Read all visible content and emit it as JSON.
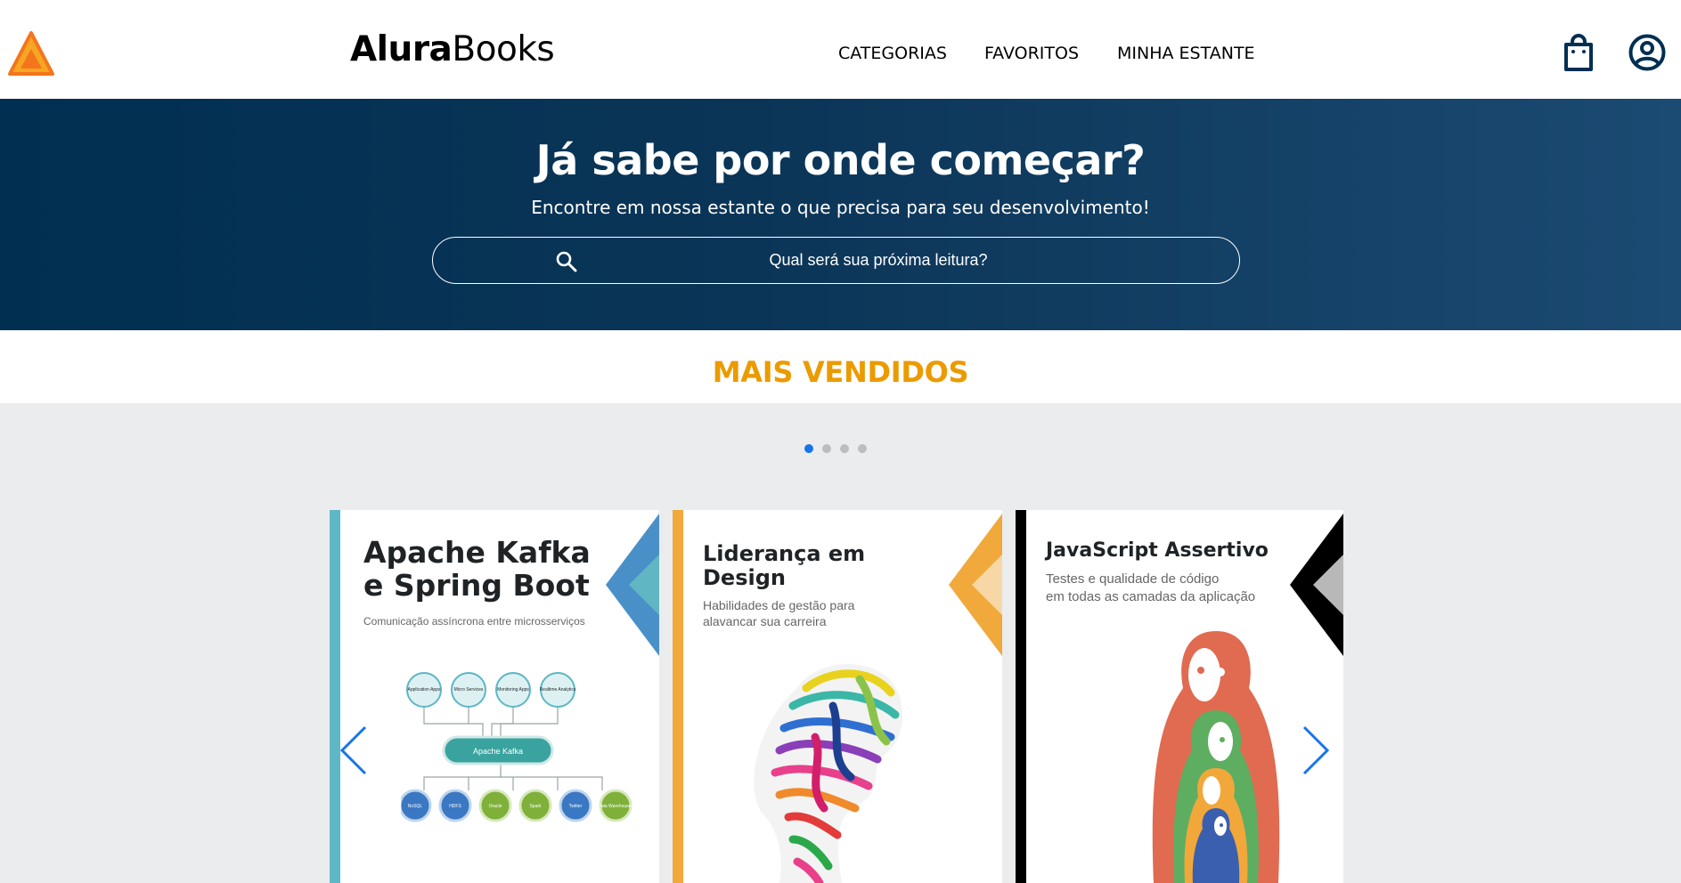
{
  "header": {
    "brand_bold": "Alura",
    "brand_light": "Books",
    "nav": [
      "CATEGORIAS",
      "FAVORITOS",
      "MINHA ESTANTE"
    ],
    "icons": [
      "logo-triangle-icon",
      "shopping-bag-icon",
      "user-account-icon"
    ]
  },
  "hero": {
    "title": "Já sabe por onde começar?",
    "subtitle": "Encontre em nossa estante o que precisa para seu desenvolvimento!",
    "search_placeholder": "Qual será sua próxima leitura?"
  },
  "section": {
    "title": "MAIS VENDIDOS",
    "carousel_pages": 4,
    "active_page": 1
  },
  "books": [
    {
      "title": "Apache Kafka\ne Spring Boot",
      "subtitle": "Comunicação assíncrona entre microsserviços",
      "accent": "#4A90C8",
      "spine": "#5DB7C4",
      "diagram": {
        "top": [
          "Application Apps",
          "Micro Services",
          "Monitoring Apps",
          "Realtime Analytics"
        ],
        "center": "Apache Kafka",
        "bottom": [
          "NoSQL",
          "HDFS",
          "Oracle",
          "Spark",
          "Twitter",
          "Data Warehouses"
        ]
      }
    },
    {
      "title": "Liderança em\nDesign",
      "subtitle": "Habilidades de gestão para\nalavancar sua carreira",
      "accent": "#F0A93A",
      "spine": "#F0A93A"
    },
    {
      "title": "JavaScript Assertivo",
      "subtitle": "Testes e qualidade de código\nem todas as camadas da aplicação",
      "accent": "#000000",
      "spine": "#000000"
    }
  ],
  "colors": {
    "hero_dark": "#002F52",
    "hero_light": "#1B4A72",
    "section_title": "#EB9B00",
    "dot_active": "#1875E8",
    "arrow": "#1875E8"
  }
}
